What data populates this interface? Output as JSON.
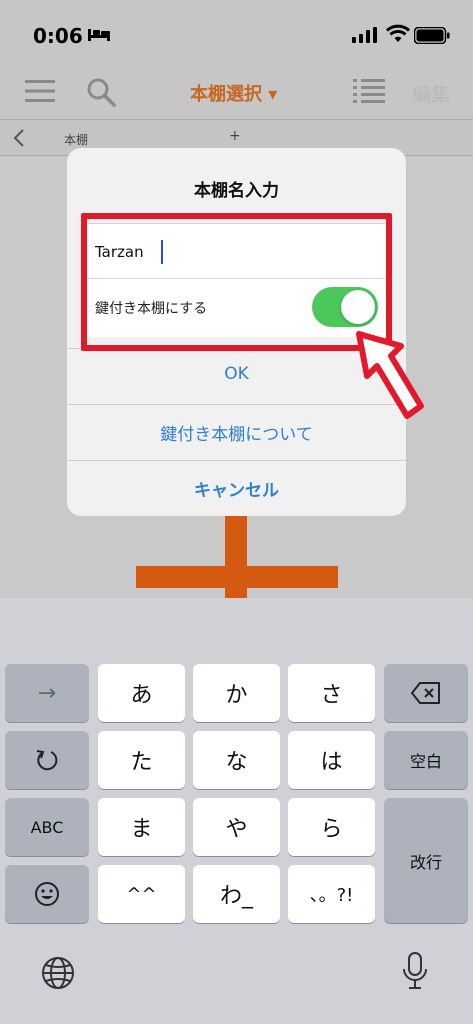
{
  "status_bar": {
    "time": "0:06"
  },
  "toolbar": {
    "title": "本棚選択 ▾",
    "edit_label": "編集"
  },
  "tabs": {
    "current": "本棚",
    "add": "+"
  },
  "dialog": {
    "title": "本棚名入力",
    "name_value": "Tarzan",
    "lock_label": "鍵付き本棚にする",
    "lock_enabled": true,
    "ok_label": "OK",
    "about_label": "鍵付き本棚について",
    "cancel_label": "キャンセル"
  },
  "keyboard": {
    "row1": [
      "→",
      "あ",
      "か",
      "さ"
    ],
    "row2": [
      "た",
      "な",
      "は",
      "空白"
    ],
    "row3": [
      "ABC",
      "ま",
      "や",
      "ら",
      "改行"
    ],
    "row4": [
      "^^",
      "わ_",
      "、。?!"
    ]
  },
  "colors": {
    "accent": "#2f7fd2",
    "title_orange": "#c86820",
    "highlight": "#e01a2b",
    "toggle_on": "#4cc75a"
  }
}
